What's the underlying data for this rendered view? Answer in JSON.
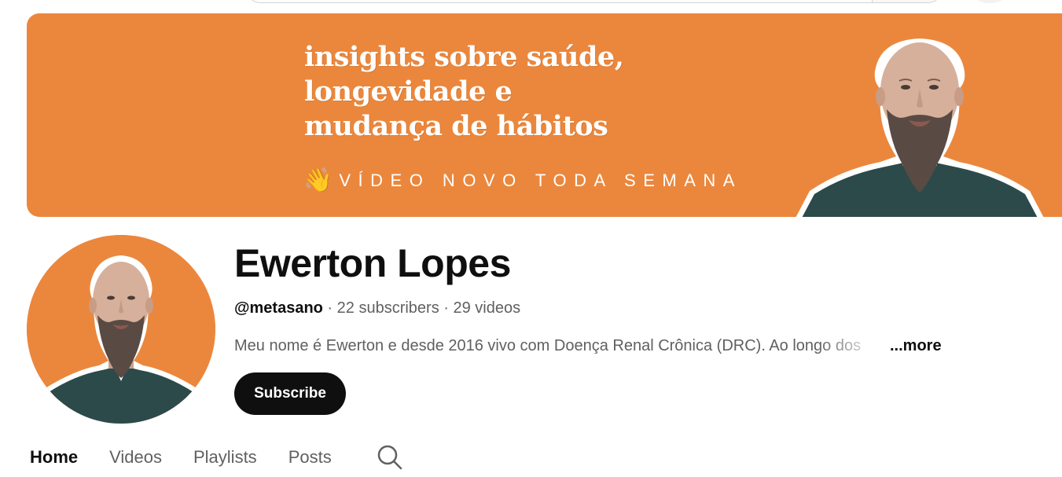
{
  "banner": {
    "headline_lines": [
      "insights sobre saúde,",
      "longevidade e",
      "mudança de hábitos"
    ],
    "tagline": "VÍDEO NOVO TODA SEMANA",
    "wave_icon": "waving-hand-icon",
    "background_color": "#eb873c"
  },
  "channel": {
    "name": "Ewerton Lopes",
    "handle": "@metasano",
    "separator": " · ",
    "subscribers": "22 subscribers",
    "videos": "29 videos",
    "description": "Meu nome é Ewerton e desde 2016 vivo com Doença Renal Crônica (DRC). Ao longo dos",
    "more_label": "...more",
    "subscribe_label": "Subscribe"
  },
  "tabs": [
    {
      "label": "Home",
      "active": true
    },
    {
      "label": "Videos",
      "active": false
    },
    {
      "label": "Playlists",
      "active": false
    },
    {
      "label": "Posts",
      "active": false
    }
  ],
  "tab_search_icon": "search-icon",
  "colors": {
    "accent_orange": "#eb873c",
    "text_primary": "#0f0f0f",
    "text_secondary": "#606060",
    "button_dark": "#0f0f0f"
  }
}
